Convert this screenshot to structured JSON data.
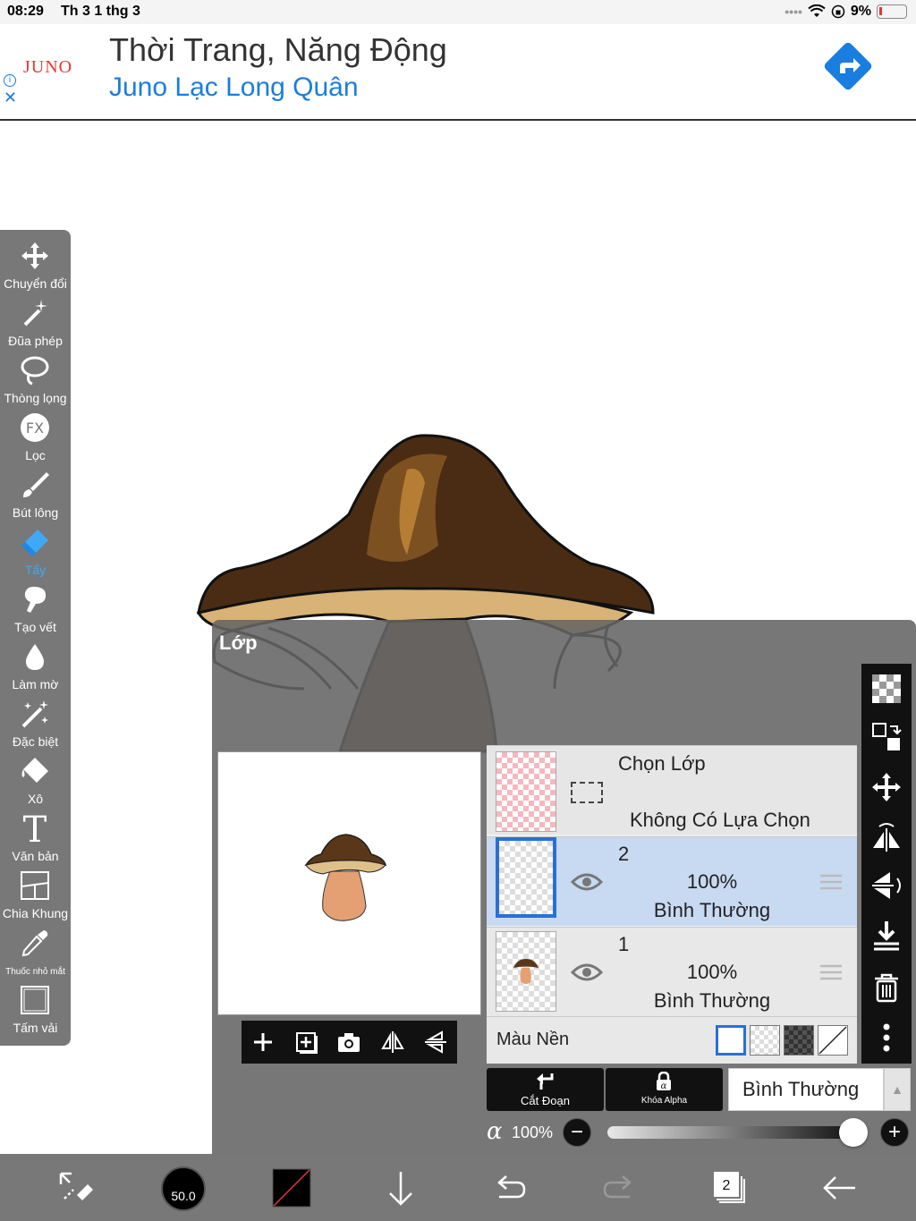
{
  "status_bar": {
    "time": "08:29",
    "date": "Th 3 1 thg 3",
    "battery": "9%"
  },
  "ad": {
    "logo": "JUNO",
    "title": "Thời Trang, Năng Động",
    "subtitle": "Juno Lạc Long Quân",
    "info_label": "i",
    "close_label": "✕"
  },
  "left_tools": [
    {
      "label": "Chuyển đổi",
      "icon": "move-icon"
    },
    {
      "label": "Đũa phép",
      "icon": "magic-wand-icon"
    },
    {
      "label": "Thòng lọng",
      "icon": "lasso-icon"
    },
    {
      "label": "Lọc",
      "icon": "fx-icon"
    },
    {
      "label": "Bút lông",
      "icon": "brush-icon"
    },
    {
      "label": "Tẩy",
      "icon": "eraser-icon",
      "active": true
    },
    {
      "label": "Tạo vết",
      "icon": "smudge-icon"
    },
    {
      "label": "Làm mờ",
      "icon": "blur-icon"
    },
    {
      "label": "Đặc biệt",
      "icon": "special-icon"
    },
    {
      "label": "Xô",
      "icon": "bucket-icon"
    },
    {
      "label": "Văn bản",
      "icon": "text-icon"
    },
    {
      "label": "Chia Khung",
      "icon": "frame-divider-icon"
    },
    {
      "label": "Thuốc nhỏ mắt",
      "icon": "eyedropper-icon"
    },
    {
      "label": "Tấm vải",
      "icon": "canvas-icon"
    }
  ],
  "layers_panel": {
    "title": "Lớp",
    "select_layer": {
      "title": "Chọn Lớp",
      "status": "Không Có Lựa Chọn"
    },
    "layers": [
      {
        "number": "2",
        "opacity": "100%",
        "mode": "Bình Thường",
        "active": true
      },
      {
        "number": "1",
        "opacity": "100%",
        "mode": "Bình Thường",
        "active": false
      }
    ],
    "background": {
      "label": "Màu Nền"
    },
    "clip_label": "Cắt Đoạn",
    "alpha_lock_label": "Khóa Alpha",
    "blend_mode": "Bình Thường",
    "alpha_symbol": "α",
    "opacity": "100%",
    "opacity_fraction": 1.0,
    "minus": "−",
    "plus": "+"
  },
  "bottom_bar": {
    "brush_size": "50.0",
    "layer_count": "2"
  },
  "colors": {
    "accent": "#3fa9f5",
    "active_layer": "#c8d9f2",
    "toolbar": "#787878",
    "panel": "#646464"
  }
}
